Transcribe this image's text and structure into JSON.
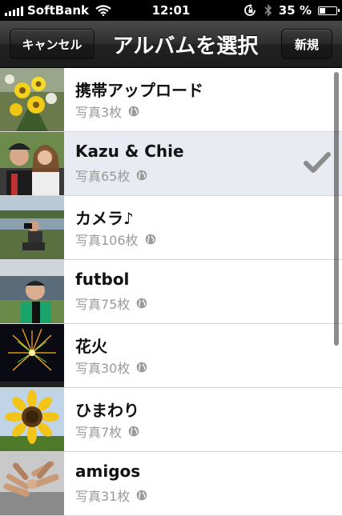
{
  "status_bar": {
    "carrier": "SoftBank",
    "time": "12:01",
    "battery_text": "35 %",
    "battery_level": 0.35,
    "icons": [
      "signal-icon",
      "wifi-icon",
      "rotation-lock-icon",
      "bluetooth-icon",
      "battery-icon"
    ]
  },
  "navbar": {
    "cancel_label": "キャンセル",
    "title": "アルバムを選択",
    "new_label": "新規"
  },
  "albums": [
    {
      "name": "携帯アップロード",
      "count": "写真3枚",
      "selected": false,
      "thumb": "bouquet"
    },
    {
      "name": "Kazu & Chie",
      "count": "写真65枚",
      "selected": true,
      "thumb": "couple"
    },
    {
      "name": "カメラ♪",
      "count": "写真106枚",
      "selected": false,
      "thumb": "photographer"
    },
    {
      "name": "futbol",
      "count": "写真75枚",
      "selected": false,
      "thumb": "stadium"
    },
    {
      "name": "花火",
      "count": "写真30枚",
      "selected": false,
      "thumb": "fireworks"
    },
    {
      "name": "ひまわり",
      "count": "写真7枚",
      "selected": false,
      "thumb": "sunflower"
    },
    {
      "name": "amigos",
      "count": "写真31枚",
      "selected": false,
      "thumb": "hands"
    }
  ]
}
